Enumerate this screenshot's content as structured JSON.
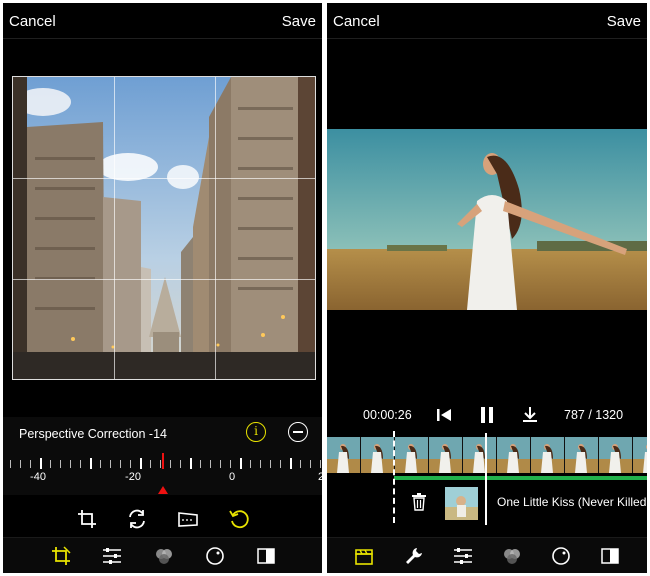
{
  "left": {
    "cancel": "Cancel",
    "save": "Save",
    "adjustment_label": "Perspective Correction -14",
    "info_symbol": "i",
    "ruler_labels": [
      "-40",
      "-20",
      "0",
      "2"
    ],
    "ruler_value": -14,
    "tools": [
      "crop-icon",
      "flip-icon",
      "perspective-icon",
      "rotate-icon"
    ],
    "nav": [
      "crop-nav-icon",
      "adjust-sliders-icon",
      "color-circles-icon",
      "vignette-icon",
      "compare-icon"
    ],
    "active_color": "#e8e300"
  },
  "right": {
    "cancel": "Cancel",
    "save": "Save",
    "timecode": "00:00:26",
    "frame_count": "787 / 1320",
    "song_title": "One Little Kiss (Never Killed",
    "nav": [
      "clapper-icon",
      "wrench-icon",
      "adjust-sliders-icon",
      "color-circles-icon",
      "vignette-icon",
      "compare-icon"
    ],
    "audio_color": "#22b14c"
  }
}
